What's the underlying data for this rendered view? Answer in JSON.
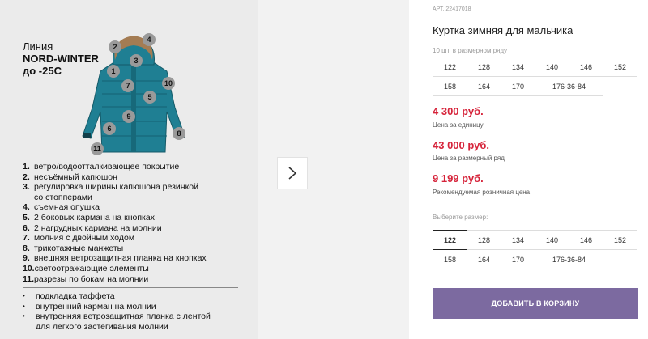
{
  "image_panel": {
    "line_title": [
      "Линия",
      "NORD-WINTER",
      "до -25С"
    ],
    "markers": [
      "1",
      "2",
      "3",
      "4",
      "5",
      "6",
      "7",
      "8",
      "9",
      "10",
      "11"
    ],
    "features": [
      {
        "num": "1.",
        "text": "ветро/водоотталкивающее покрытие"
      },
      {
        "num": "2.",
        "text": "несъёмный капюшон"
      },
      {
        "num": "3.",
        "text": "регулировка ширины капюшона  резинкой",
        "cont": "со стопперами"
      },
      {
        "num": "4.",
        "text": "съемная опушка"
      },
      {
        "num": "5.",
        "text": " 2 боковых кармана на кнопках"
      },
      {
        "num": "6.",
        "text": " 2  нагрудных кармана на молнии"
      },
      {
        "num": "7.",
        "text": " молния с двойным ходом"
      },
      {
        "num": "8.",
        "text": "трикотажные манжеты"
      },
      {
        "num": "9.",
        "text": "внешняя ветрозащитная планка на кнопках"
      },
      {
        "num": "10.",
        "text": "светоотражающие элементы"
      },
      {
        "num": "11.",
        "text": "разрезы по бокам на молнии"
      }
    ],
    "bullets": [
      {
        "text": "подкладка таффета"
      },
      {
        "text": "внутренний карман на молнии"
      },
      {
        "text": "внутренняя ветрозащитная планка с лентой",
        "cont": "для легкого застегивания молнии"
      }
    ],
    "bullet_symbol": "•",
    "next_icon": "chevron-right"
  },
  "product": {
    "article": "АРТ. 22417018",
    "title": "Куртка зимняя для мальчика",
    "row_note": "10 шт. в размерном ряду",
    "size_row_sizes": [
      "122",
      "128",
      "134",
      "140",
      "146",
      "152",
      "158",
      "164",
      "170",
      "176-36-84"
    ],
    "prices": [
      {
        "value": "4 300 руб.",
        "label": "Цена за единицу"
      },
      {
        "value": "43 000 руб.",
        "label": "Цена за размерный ряд"
      },
      {
        "value": "9 199 руб.",
        "label": "Рекомендуемая розничная цена"
      }
    ],
    "choose_label": "Выберите размер:",
    "choose_sizes": [
      "122",
      "128",
      "134",
      "140",
      "146",
      "152",
      "158",
      "164",
      "170",
      "176-36-84"
    ],
    "selected_size": "122",
    "cart_button": "ДОБАВИТЬ В КОРЗИНУ"
  },
  "colors": {
    "price": "#d6233a",
    "cart_button": "#7c6aa0",
    "jacket": "#1f7f93"
  }
}
